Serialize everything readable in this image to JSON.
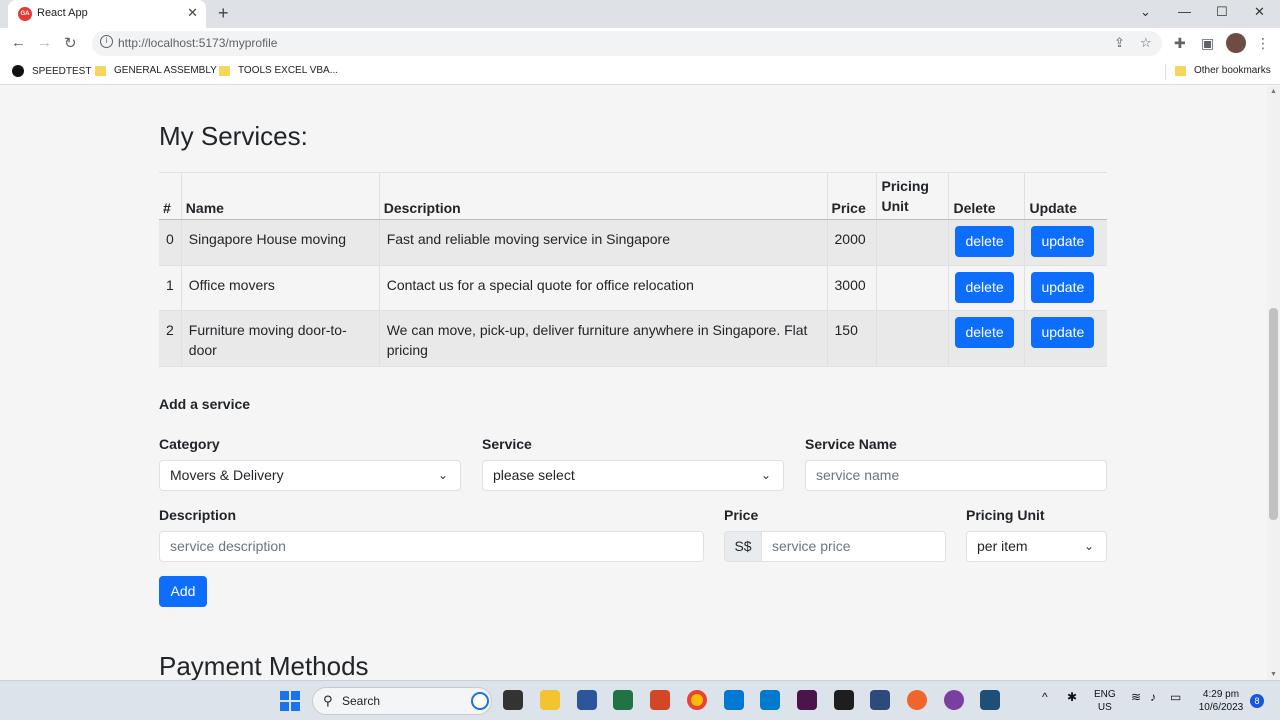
{
  "browser": {
    "tab_title": "React App",
    "url": "http://localhost:5173/myprofile",
    "bookmarks": [
      "SPEEDTEST",
      "GENERAL ASSEMBLY",
      "TOOLS EXCEL VBA..."
    ],
    "other_bookmarks": "Other bookmarks"
  },
  "services": {
    "heading": "My Services:",
    "columns": [
      "#",
      "Name",
      "Description",
      "Price",
      "Pricing Unit",
      "Delete",
      "Update"
    ],
    "rows": [
      {
        "index": "0",
        "name": "Singapore House moving",
        "description": "Fast and reliable moving service in Singapore",
        "price": "2000",
        "unit": ""
      },
      {
        "index": "1",
        "name": "Office movers",
        "description": "Contact us for a special quote for office relocation",
        "price": "3000",
        "unit": ""
      },
      {
        "index": "2",
        "name": "Furniture moving door-to-door",
        "description": "We can move, pick-up, deliver furniture anywhere in Singapore. Flat pricing",
        "price": "150",
        "unit": ""
      }
    ],
    "delete_label": "delete",
    "update_label": "update"
  },
  "add_service": {
    "heading": "Add a service",
    "category_label": "Category",
    "category_value": "Movers & Delivery",
    "service_label": "Service",
    "service_value": "please select",
    "service_name_label": "Service Name",
    "service_name_placeholder": "service name",
    "description_label": "Description",
    "description_placeholder": "service description",
    "price_label": "Price",
    "currency": "S$",
    "price_placeholder": "service price",
    "pricing_unit_label": "Pricing Unit",
    "pricing_unit_value": "per item",
    "add_label": "Add"
  },
  "payment": {
    "heading": "Payment Methods"
  },
  "taskbar": {
    "search_label": "Search",
    "lang_top": "ENG",
    "lang_bottom": "US",
    "time": "4:29 pm",
    "date": "10/6/2023",
    "notification_count": "8"
  },
  "colors": {
    "primary": "#0d6efd",
    "page_bg": "#f5f5f5",
    "row_alt": "#e9e9e9"
  }
}
